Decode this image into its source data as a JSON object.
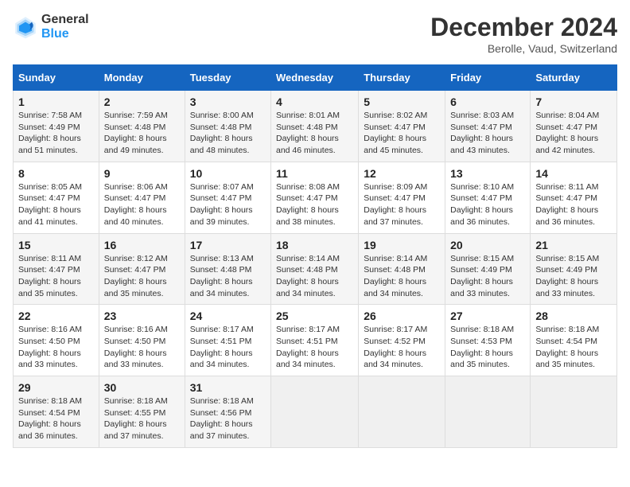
{
  "header": {
    "logo_line1": "General",
    "logo_line2": "Blue",
    "month": "December 2024",
    "location": "Berolle, Vaud, Switzerland"
  },
  "weekdays": [
    "Sunday",
    "Monday",
    "Tuesday",
    "Wednesday",
    "Thursday",
    "Friday",
    "Saturday"
  ],
  "weeks": [
    [
      {
        "day": "1",
        "info": "Sunrise: 7:58 AM\nSunset: 4:49 PM\nDaylight: 8 hours\nand 51 minutes."
      },
      {
        "day": "2",
        "info": "Sunrise: 7:59 AM\nSunset: 4:48 PM\nDaylight: 8 hours\nand 49 minutes."
      },
      {
        "day": "3",
        "info": "Sunrise: 8:00 AM\nSunset: 4:48 PM\nDaylight: 8 hours\nand 48 minutes."
      },
      {
        "day": "4",
        "info": "Sunrise: 8:01 AM\nSunset: 4:48 PM\nDaylight: 8 hours\nand 46 minutes."
      },
      {
        "day": "5",
        "info": "Sunrise: 8:02 AM\nSunset: 4:47 PM\nDaylight: 8 hours\nand 45 minutes."
      },
      {
        "day": "6",
        "info": "Sunrise: 8:03 AM\nSunset: 4:47 PM\nDaylight: 8 hours\nand 43 minutes."
      },
      {
        "day": "7",
        "info": "Sunrise: 8:04 AM\nSunset: 4:47 PM\nDaylight: 8 hours\nand 42 minutes."
      }
    ],
    [
      {
        "day": "8",
        "info": "Sunrise: 8:05 AM\nSunset: 4:47 PM\nDaylight: 8 hours\nand 41 minutes."
      },
      {
        "day": "9",
        "info": "Sunrise: 8:06 AM\nSunset: 4:47 PM\nDaylight: 8 hours\nand 40 minutes."
      },
      {
        "day": "10",
        "info": "Sunrise: 8:07 AM\nSunset: 4:47 PM\nDaylight: 8 hours\nand 39 minutes."
      },
      {
        "day": "11",
        "info": "Sunrise: 8:08 AM\nSunset: 4:47 PM\nDaylight: 8 hours\nand 38 minutes."
      },
      {
        "day": "12",
        "info": "Sunrise: 8:09 AM\nSunset: 4:47 PM\nDaylight: 8 hours\nand 37 minutes."
      },
      {
        "day": "13",
        "info": "Sunrise: 8:10 AM\nSunset: 4:47 PM\nDaylight: 8 hours\nand 36 minutes."
      },
      {
        "day": "14",
        "info": "Sunrise: 8:11 AM\nSunset: 4:47 PM\nDaylight: 8 hours\nand 36 minutes."
      }
    ],
    [
      {
        "day": "15",
        "info": "Sunrise: 8:11 AM\nSunset: 4:47 PM\nDaylight: 8 hours\nand 35 minutes."
      },
      {
        "day": "16",
        "info": "Sunrise: 8:12 AM\nSunset: 4:47 PM\nDaylight: 8 hours\nand 35 minutes."
      },
      {
        "day": "17",
        "info": "Sunrise: 8:13 AM\nSunset: 4:48 PM\nDaylight: 8 hours\nand 34 minutes."
      },
      {
        "day": "18",
        "info": "Sunrise: 8:14 AM\nSunset: 4:48 PM\nDaylight: 8 hours\nand 34 minutes."
      },
      {
        "day": "19",
        "info": "Sunrise: 8:14 AM\nSunset: 4:48 PM\nDaylight: 8 hours\nand 34 minutes."
      },
      {
        "day": "20",
        "info": "Sunrise: 8:15 AM\nSunset: 4:49 PM\nDaylight: 8 hours\nand 33 minutes."
      },
      {
        "day": "21",
        "info": "Sunrise: 8:15 AM\nSunset: 4:49 PM\nDaylight: 8 hours\nand 33 minutes."
      }
    ],
    [
      {
        "day": "22",
        "info": "Sunrise: 8:16 AM\nSunset: 4:50 PM\nDaylight: 8 hours\nand 33 minutes."
      },
      {
        "day": "23",
        "info": "Sunrise: 8:16 AM\nSunset: 4:50 PM\nDaylight: 8 hours\nand 33 minutes."
      },
      {
        "day": "24",
        "info": "Sunrise: 8:17 AM\nSunset: 4:51 PM\nDaylight: 8 hours\nand 34 minutes."
      },
      {
        "day": "25",
        "info": "Sunrise: 8:17 AM\nSunset: 4:51 PM\nDaylight: 8 hours\nand 34 minutes."
      },
      {
        "day": "26",
        "info": "Sunrise: 8:17 AM\nSunset: 4:52 PM\nDaylight: 8 hours\nand 34 minutes."
      },
      {
        "day": "27",
        "info": "Sunrise: 8:18 AM\nSunset: 4:53 PM\nDaylight: 8 hours\nand 35 minutes."
      },
      {
        "day": "28",
        "info": "Sunrise: 8:18 AM\nSunset: 4:54 PM\nDaylight: 8 hours\nand 35 minutes."
      }
    ],
    [
      {
        "day": "29",
        "info": "Sunrise: 8:18 AM\nSunset: 4:54 PM\nDaylight: 8 hours\nand 36 minutes."
      },
      {
        "day": "30",
        "info": "Sunrise: 8:18 AM\nSunset: 4:55 PM\nDaylight: 8 hours\nand 37 minutes."
      },
      {
        "day": "31",
        "info": "Sunrise: 8:18 AM\nSunset: 4:56 PM\nDaylight: 8 hours\nand 37 minutes."
      },
      null,
      null,
      null,
      null
    ]
  ]
}
